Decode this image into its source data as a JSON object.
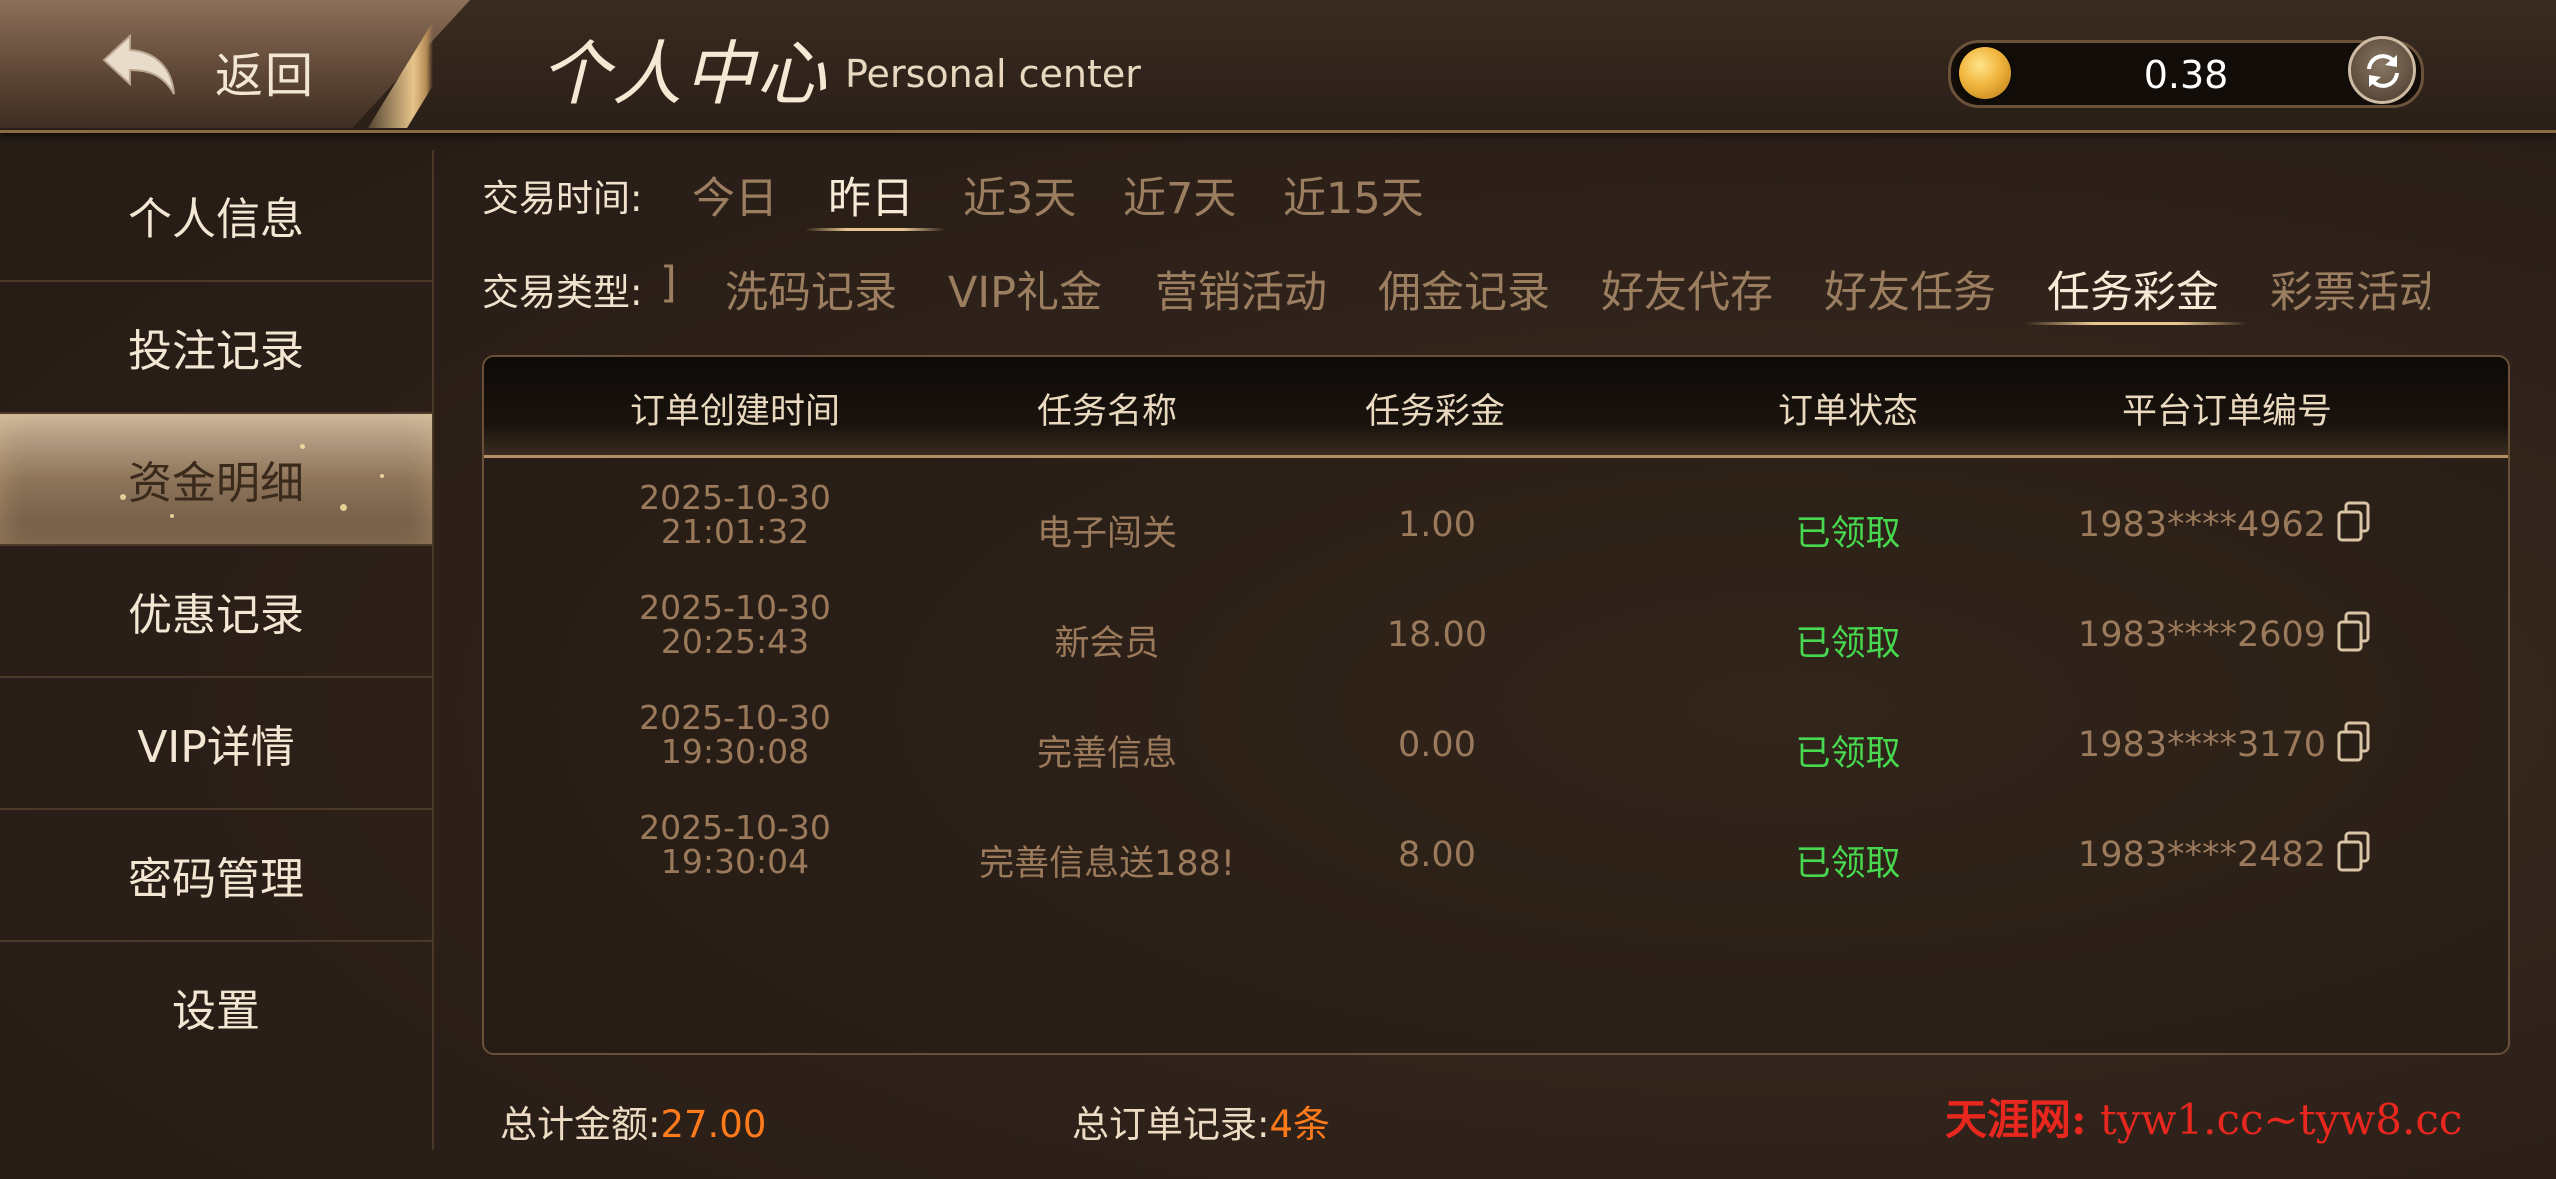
{
  "header": {
    "back_label": "返回",
    "title_cn": "个人中心",
    "title_en": "Personal center",
    "balance": "0.38"
  },
  "sidebar": {
    "items": [
      {
        "label": "个人信息"
      },
      {
        "label": "投注记录"
      },
      {
        "label": "资金明细",
        "active": true
      },
      {
        "label": "优惠记录"
      },
      {
        "label": "VIP详情"
      },
      {
        "label": "密码管理"
      },
      {
        "label": "设置"
      }
    ]
  },
  "filters": {
    "time_label": "交易时间:",
    "time_options": [
      "今日",
      "昨日",
      "近3天",
      "近7天",
      "近15天"
    ],
    "time_selected": "昨日",
    "type_label": "交易类型:",
    "type_options": [
      "]",
      "洗码记录",
      "VIP礼金",
      "营销活动",
      "佣金记录",
      "好友代存",
      "好友任务",
      "任务彩金",
      "彩票活动"
    ],
    "type_selected": "任务彩金"
  },
  "table": {
    "headers": [
      "订单创建时间",
      "任务名称",
      "任务彩金",
      "订单状态",
      "平台订单编号"
    ],
    "rows": [
      {
        "date": "2025-10-30",
        "time": "21:01:32",
        "name": "电子闯关",
        "amount": "1.00",
        "status": "已领取",
        "order_no": "1983****4962"
      },
      {
        "date": "2025-10-30",
        "time": "20:25:43",
        "name": "新会员",
        "amount": "18.00",
        "status": "已领取",
        "order_no": "1983****2609"
      },
      {
        "date": "2025-10-30",
        "time": "19:30:08",
        "name": "完善信息",
        "amount": "0.00",
        "status": "已领取",
        "order_no": "1983****3170"
      },
      {
        "date": "2025-10-30",
        "time": "19:30:04",
        "name": "完善信息送188!",
        "amount": "8.00",
        "status": "已领取",
        "order_no": "1983****2482"
      }
    ]
  },
  "footer": {
    "total_amount_label": "总计金额:",
    "total_amount": "27.00",
    "total_records_label": "总订单记录:",
    "total_records": "4条"
  },
  "watermark": {
    "brand": "天涯网:",
    "domains": "tyw1.cc~tyw8.cc"
  },
  "colors": {
    "status_green": "#47d84f",
    "accent_orange": "#ff7a1a",
    "watermark_red": "#e8271e"
  }
}
